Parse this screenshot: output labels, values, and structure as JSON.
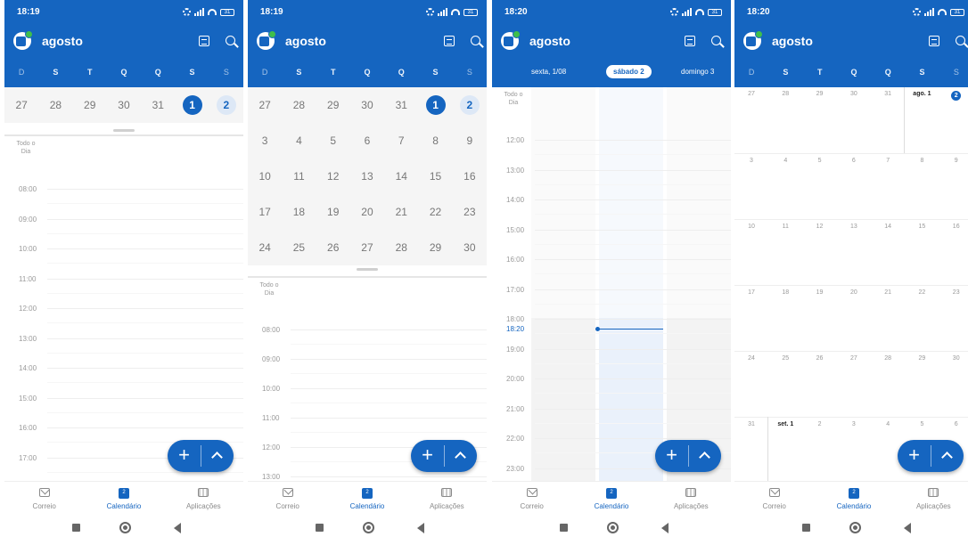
{
  "colors": {
    "brand": "#1565c0"
  },
  "status_times": [
    "18:19",
    "18:19",
    "18:20",
    "18:20"
  ],
  "battery": "31",
  "month_title": "agosto",
  "weekday_initials": [
    "D",
    "S",
    "T",
    "Q",
    "Q",
    "S",
    "S"
  ],
  "icons": {
    "app": "outlook-calendar-logo",
    "view": "calendar-view-icon",
    "search": "search-icon"
  },
  "all_day_label": "Todo o Dia",
  "panel1": {
    "week_days": [
      "27",
      "28",
      "29",
      "30",
      "31",
      "1",
      "2"
    ],
    "hours": [
      "08:00",
      "09:00",
      "10:00",
      "11:00",
      "12:00",
      "13:00",
      "14:00",
      "15:00",
      "16:00",
      "17:00"
    ]
  },
  "panel2": {
    "weeks": [
      [
        "27",
        "28",
        "29",
        "30",
        "31",
        "1",
        "2"
      ],
      [
        "3",
        "4",
        "5",
        "6",
        "7",
        "8",
        "9"
      ],
      [
        "10",
        "11",
        "12",
        "13",
        "14",
        "15",
        "16"
      ],
      [
        "17",
        "18",
        "19",
        "20",
        "21",
        "22",
        "23"
      ],
      [
        "24",
        "25",
        "26",
        "27",
        "28",
        "29",
        "30"
      ]
    ],
    "hours": [
      "08:00",
      "09:00",
      "10:00",
      "11:00",
      "12:00",
      "13:00"
    ]
  },
  "panel3": {
    "days": [
      "sexta, 1/08",
      "sábado 2",
      "domingo 3"
    ],
    "hours": [
      "12:00",
      "13:00",
      "14:00",
      "15:00",
      "16:00",
      "17:00",
      "18:00",
      "19:00",
      "20:00",
      "21:00",
      "22:00",
      "23:00"
    ],
    "now_time": "18:20"
  },
  "panel4": {
    "weeks": [
      [
        "27",
        "28",
        "29",
        "30",
        "31",
        "ago. 1",
        "2"
      ],
      [
        "3",
        "4",
        "5",
        "6",
        "7",
        "8",
        "9"
      ],
      [
        "10",
        "11",
        "12",
        "13",
        "14",
        "15",
        "16"
      ],
      [
        "17",
        "18",
        "19",
        "20",
        "21",
        "22",
        "23"
      ],
      [
        "24",
        "25",
        "26",
        "27",
        "28",
        "29",
        "30"
      ],
      [
        "31",
        "set. 1",
        "2",
        "3",
        "4",
        "5",
        "6"
      ]
    ]
  },
  "fab": {
    "add": "+"
  },
  "bottom_nav": [
    {
      "label": "Correio",
      "icon": "mail-icon"
    },
    {
      "label": "Calendário",
      "icon": "calendar-icon",
      "badge": "2"
    },
    {
      "label": "Aplicações",
      "icon": "apps-grid-icon"
    }
  ]
}
